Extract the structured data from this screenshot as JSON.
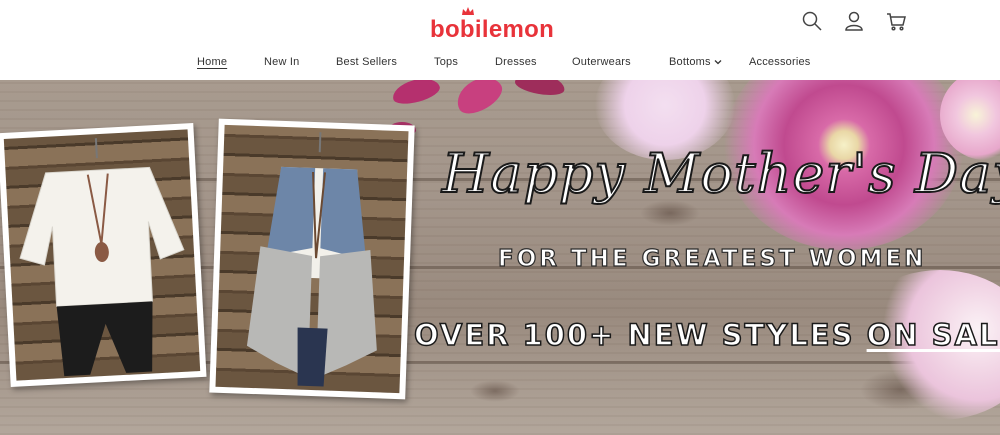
{
  "brand": {
    "name": "bobilemon",
    "color": "#e8333a"
  },
  "header_icons": [
    "search-icon",
    "user-icon",
    "cart-icon"
  ],
  "nav": {
    "items": [
      {
        "label": "Home",
        "active": true
      },
      {
        "label": "New In"
      },
      {
        "label": "Best Sellers"
      },
      {
        "label": "Tops"
      },
      {
        "label": "Dresses"
      },
      {
        "label": "Outerwears"
      },
      {
        "label": "Bottoms",
        "dropdown": true
      },
      {
        "label": "Accessories"
      }
    ]
  },
  "hero": {
    "headline": "Happy Mother's Day",
    "subheadline": "FOR THE GREATEST WOMEN",
    "offer_prefix": "OVER 100+ NEW STYLES ",
    "offer_link": "ON SALE"
  }
}
